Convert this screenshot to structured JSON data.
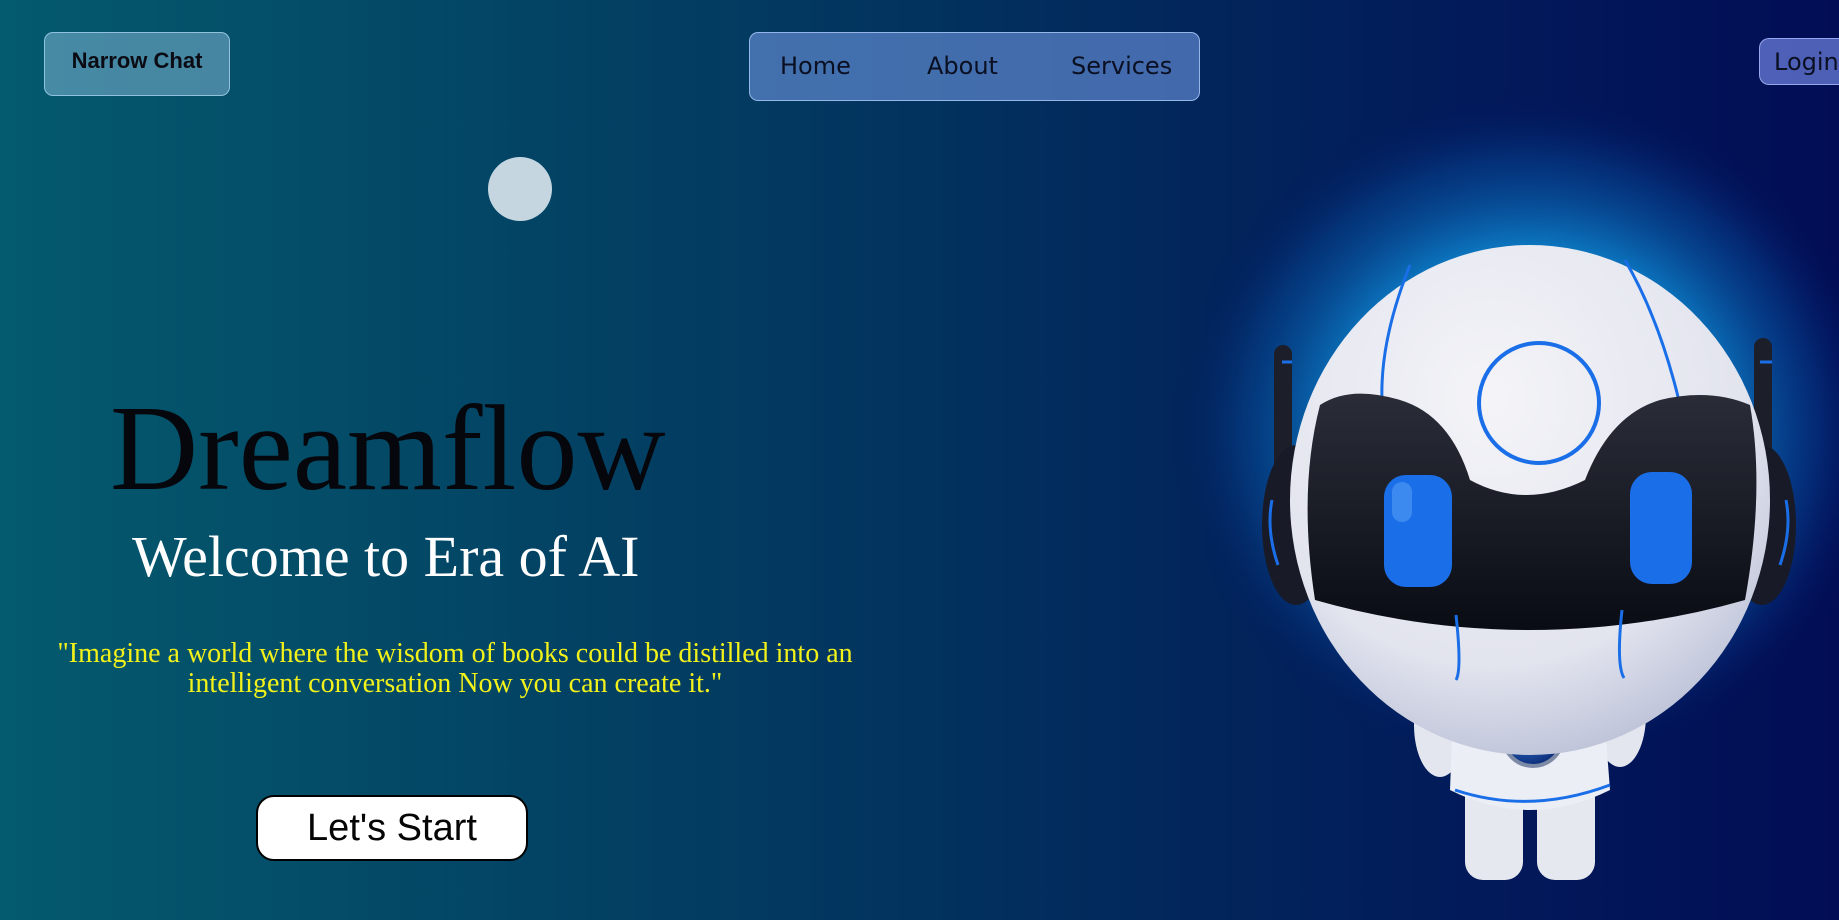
{
  "header": {
    "brand_label": "Narrow Chat",
    "nav_items": [
      {
        "label": "Home"
      },
      {
        "label": "About"
      },
      {
        "label": "Services"
      }
    ],
    "login_label": "Login"
  },
  "hero": {
    "title": "Dreamflow",
    "subtitle": "Welcome to Era of AI",
    "quote": "\"Imagine a world where the wisdom of books could be distilled into an intelligent conversation Now you can create it.\"",
    "cta_label": "Let's Start"
  },
  "colors": {
    "background_left": "#045a6e",
    "background_right": "#020d55",
    "quote_text": "#f2f21a",
    "title_text": "#05070c",
    "subtitle_text": "#ffffff",
    "robot_accent": "#1a6fe8"
  },
  "illustration": {
    "name": "robot-illustration"
  }
}
